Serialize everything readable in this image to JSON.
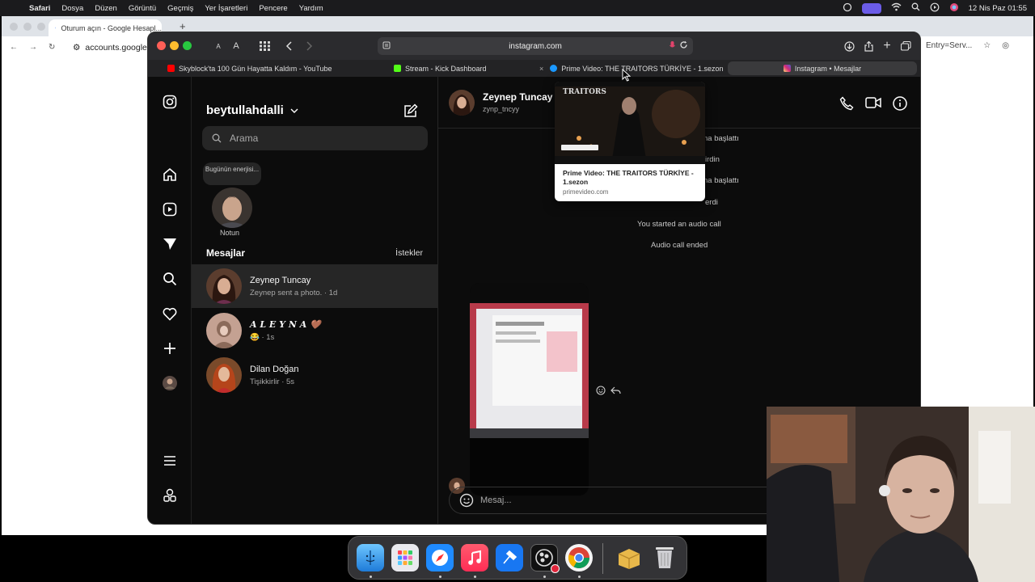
{
  "menubar": {
    "app": "Safari",
    "items": [
      "Dosya",
      "Düzen",
      "Görüntü",
      "Geçmiş",
      "Yer İşaretleri",
      "Pencere",
      "Yardım"
    ],
    "datetime": "12 Nis Paz  01:55"
  },
  "chrome": {
    "tab_title": "Oturum açın - Google Hesapl...",
    "url": "accounts.google",
    "url_right": "Entry=Serv..."
  },
  "safari": {
    "address": "instagram.com",
    "text_size_small": "A",
    "text_size_large": "A",
    "tabs": [
      {
        "label": "Skyblock'ta 100 Gün Hayatta Kaldım - YouTube"
      },
      {
        "label": "Stream - Kick Dashboard"
      },
      {
        "label": "Prime Video: THE TRAITORS TÜRKİYE - 1.sezon"
      },
      {
        "label": "Instagram • Mesajlar"
      }
    ],
    "tab_close": "×"
  },
  "tab_preview": {
    "title": "Prime Video: THE TRAITORS TÜRKİYE - 1.sezon",
    "url": "primevideo.com",
    "image_logo": "TRAITORS"
  },
  "instagram": {
    "username": "beytullahdalli",
    "search_placeholder": "Arama",
    "note_text": "Bugünün enerjisi...",
    "note_label": "Notun",
    "messages_title": "Mesajlar",
    "requests": "İstekler",
    "conversations": [
      {
        "name": "Zeynep Tuncay",
        "preview": "Zeynep sent a photo. · 1d"
      },
      {
        "name": "𝑨 𝑳 𝑬 𝒀 𝑵 𝑨 🤎",
        "preview": "😂 · 1s"
      },
      {
        "name": "Dilan Doğan",
        "preview": "Tişikkirlir · 5s"
      }
    ],
    "chat": {
      "name": "Zeynep Tuncay",
      "handle": "zynp_tncyy",
      "system_messages": [
        "na başlattı",
        "irdin",
        "na başlattı",
        "erdi",
        "You started an audio call",
        "Audio call ended"
      ],
      "composer_placeholder": "Mesaj..."
    }
  },
  "colors": {
    "ig_bg": "#0c0c0c",
    "selected_row": "#262626",
    "dock_bg": "#3c3c40"
  }
}
